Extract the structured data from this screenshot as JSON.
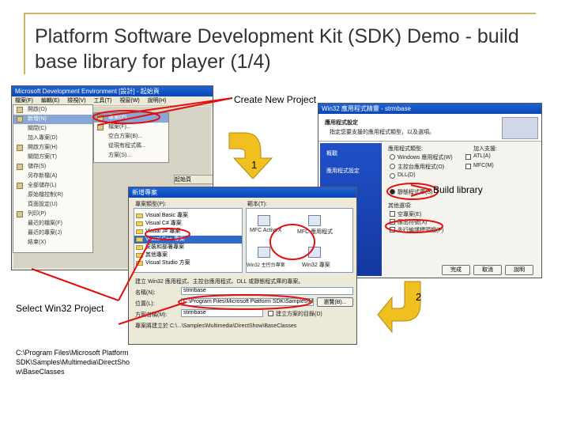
{
  "slide": {
    "title": "Platform Software Development Kit (SDK) Demo - build base library for player (1/4)"
  },
  "callouts": {
    "create_new_project": "Create New Project",
    "build_library": "Build library",
    "select_win32": "Select Win32 Project",
    "step1": "1",
    "step2": "2",
    "path_lines": [
      "C:\\Program Files\\Microsoft Platform",
      "SDK\\Samples\\Multimedia\\DirectSho",
      "w\\BaseClasses"
    ]
  },
  "vs_window": {
    "title": "Microsoft Development Environment [設計] - 起始頁",
    "menu": [
      "檔案(F)",
      "編輯(E)",
      "檢視(V)",
      "工具(T)",
      "視窗(W)",
      "說明(H)"
    ],
    "file_menu": [
      "開啟(O)",
      "新增(N)",
      "關閉(C)",
      "加入專案(D)",
      "開啟方案(H)",
      "關閉方案(T)",
      "儲存(S)",
      "另存新檔(A)",
      "全部儲存(L)",
      "原始檔控制(R)",
      "頁面設定(U)",
      "列印(P)",
      "最近的檔案(F)",
      "最近的專案(J)",
      "結束(X)"
    ],
    "new_submenu": [
      "專案(P)...",
      "檔案(F)...",
      "空白方案(B)...",
      "從現有程式碼...",
      "方案(S)..."
    ],
    "tab_label": "起始頁"
  },
  "new_project_dialog": {
    "title": "新增專案",
    "types_label": "專案類型(P):",
    "templates_label": "範本(T):",
    "folders": [
      "Visual Basic 專案",
      "Visual C# 專案",
      "Visual J# 專案",
      "Visual C++ 專案",
      "安裝和部署專案",
      "其他專案",
      "Visual Studio 方案"
    ],
    "template_items": [
      "MFC ActiveX",
      "MFC 應用程式",
      "Win32 主控台專案",
      "Win32 專案"
    ],
    "desc": "建立 Win32 應用程式、主控台應用程式、DLL 或靜態程式庫的專案。",
    "name_label": "名稱(N):",
    "name_value": "strmbase",
    "location_label": "位置(L):",
    "location_value": "C:\\Program Files\\Microsoft Platform SDK\\Samples\\Multim",
    "solution_label": "方案名稱(M):",
    "solution_value": "strmbase",
    "browse": "瀏覽(B)...",
    "new_solution": "建立方案的目錄(D)",
    "info": "專案將建立於 C:\\...\\Samples\\Multimedia\\DirectShow\\BaseClasses"
  },
  "wizard": {
    "title": "Win32 應用程式精靈 - strmbase",
    "heading": "應用程式設定",
    "subheading": "指定您要支援的應用程式類型，以及選項。",
    "nav": [
      "概觀",
      "應用程式設定"
    ],
    "app_type_label": "應用程式類型:",
    "app_types": [
      "Windows 應用程式(W)",
      "主控台應用程式(O)",
      "DLL(D)",
      "靜態程式庫(S)"
    ],
    "options_label": "其他選項:",
    "options": [
      "空專案(E)",
      "匯出符號(X)",
      "先行編譯標頭檔(P)"
    ],
    "add_support_label": "加入支援:",
    "support": [
      "ATL(A)",
      "MFC(M)"
    ],
    "finish": "完成",
    "cancel": "取消",
    "help": "說明"
  },
  "colors": {
    "accent_red": "#e01010",
    "arrow_yellow": "#f0c020",
    "frame": "#c9b860"
  }
}
